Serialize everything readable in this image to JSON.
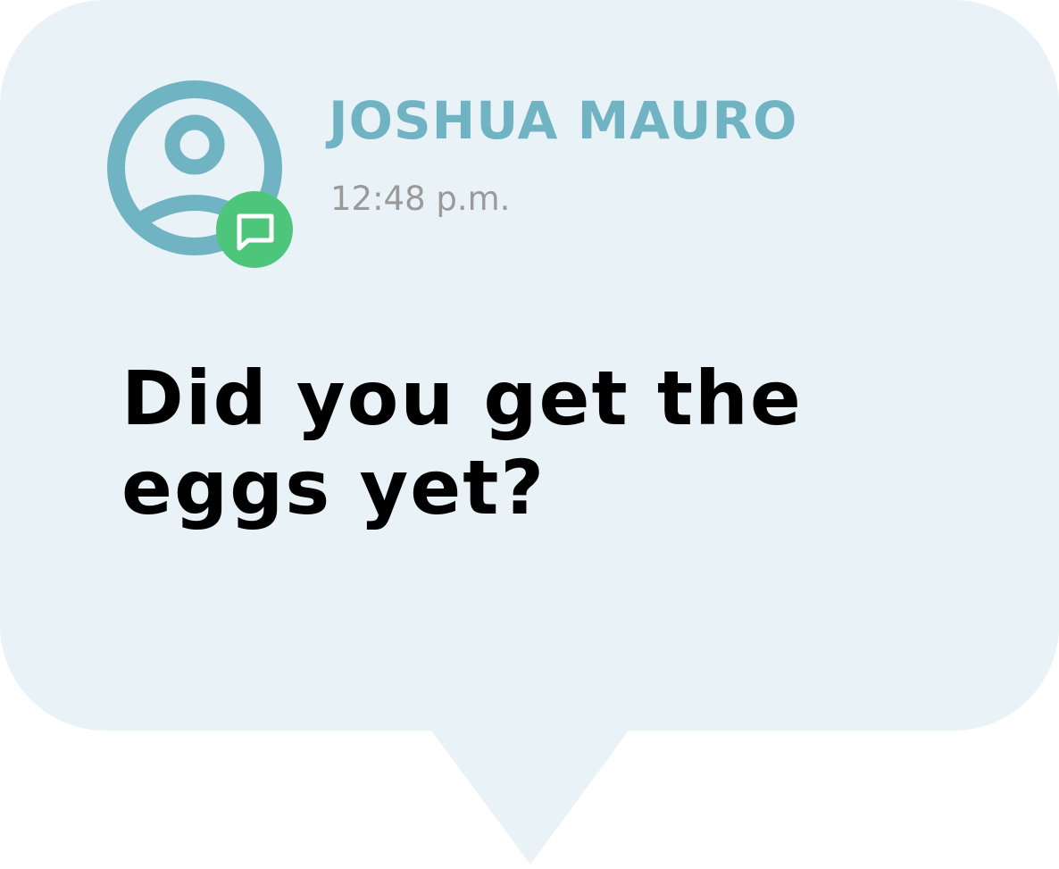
{
  "message": {
    "sender_name": "JOSHUA MAURO",
    "timestamp": "12:48 p.m.",
    "text": "Did you get the eggs yet?"
  },
  "icons": {
    "avatar": "user-circle-icon",
    "badge": "chat-bubble-icon"
  },
  "colors": {
    "bubble_background": "#e9f2f6",
    "accent": "#70b3c2",
    "badge": "#4dc67b",
    "timestamp": "#9a9a9a",
    "message_text": "#000000"
  }
}
